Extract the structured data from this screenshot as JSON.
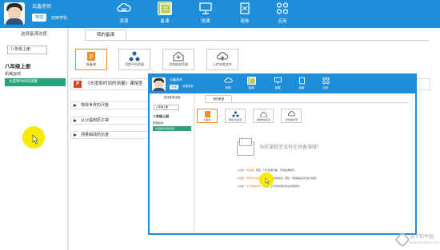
{
  "colors": {
    "primary": "#1f8ed8",
    "active_nav": "#b2c94f",
    "lesson_active": "#26a37c",
    "highlight": "#f5ea00",
    "accent": "#f28a2a"
  },
  "header": {
    "teacher_name": "吕鑫老师",
    "subject": "物理",
    "switch_label": "切换学科",
    "nav": [
      {
        "label": "资源",
        "icon": "cloud-icon"
      },
      {
        "label": "备课",
        "icon": "lesson-prep-icon",
        "active": true
      },
      {
        "label": "授课",
        "icon": "teach-icon"
      },
      {
        "label": "组卷",
        "icon": "exam-icon"
      },
      {
        "label": "应用",
        "icon": "apps-icon"
      }
    ]
  },
  "sidebar": {
    "title": "选择备课进度",
    "grade_select": "八年级上册",
    "grade": "八年级上册",
    "unit": "机械运动",
    "lesson": "长度和时间的测量"
  },
  "main": {
    "tab": "我的备课",
    "tools": [
      {
        "label": "新备课",
        "icon": "ppt-icon"
      },
      {
        "label": "添加平台资源",
        "icon": "platform-icon"
      },
      {
        "label": "添加校本资源",
        "icon": "school-add-icon"
      },
      {
        "label": "上传本地文件",
        "icon": "upload-icon"
      }
    ],
    "lesson_title": "《长度和时间的测量》课授型",
    "resources": [
      "物体世界的尺度",
      "从沙漏到原子钟",
      "测量曲线的长度"
    ]
  },
  "window": {
    "teacher_name": "吕鑫老师",
    "subject": "物理",
    "switch_label": "切换学科",
    "nav": [
      "资源",
      "备课",
      "授课",
      "组卷",
      "应用"
    ],
    "sidebar_title": "选择备课进度",
    "grade_select": "八年级上册",
    "grade": "八年级上册",
    "unit": "机械运动",
    "lesson": "长度和时间的测量",
    "tab": "我的备课",
    "tools": [
      "新备课",
      "添加平台资源",
      "添加校本资源",
      "上传本地文件"
    ],
    "empty_text": "当前课程还没有在线备课哦！",
    "hints": [
      {
        "prefix": "1.点击",
        "link": "「新备课」",
        "suffix": "按钮，打开备课界面，开始备课课件。"
      },
      {
        "prefix": "2.点击",
        "link": "「添加平台资源」",
        "suffix": "或「添加校本资源」按钮，添加精品资源进行备课。"
      },
      {
        "prefix": "3.点击",
        "link": "「上传本地文件」",
        "suffix": "按钮，上传本地课件到在线备课中。"
      }
    ]
  },
  "watermark": {
    "name": "当下软件园",
    "url": "www.downxia.com"
  }
}
